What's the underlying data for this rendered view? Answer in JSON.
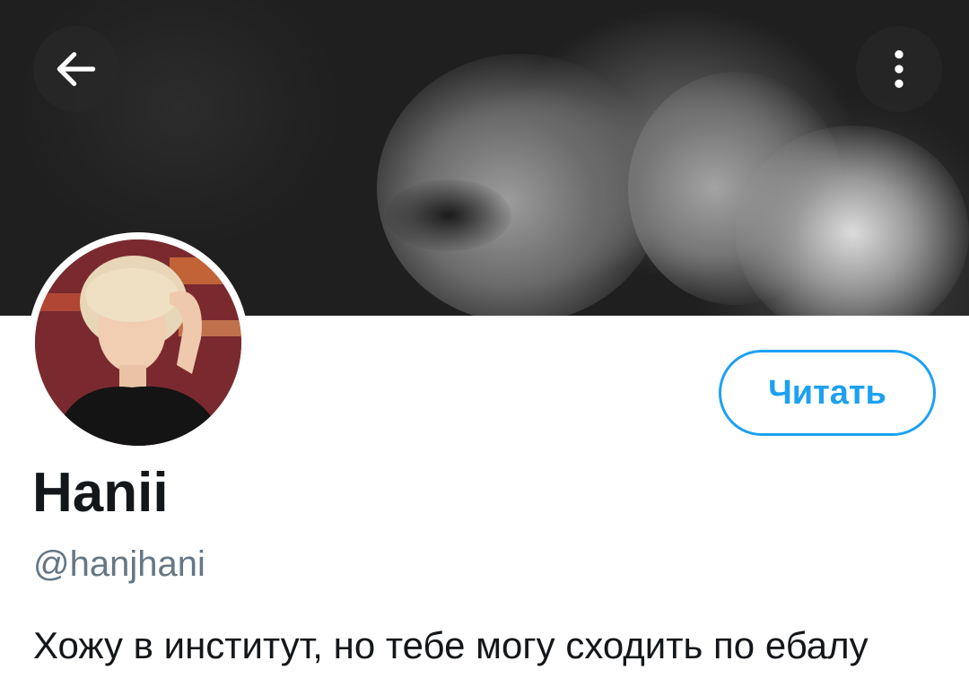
{
  "header": {
    "back_icon": "arrow-left-icon",
    "more_icon": "more-vertical-icon"
  },
  "profile": {
    "display_name": "Hanii",
    "handle": "@hanjhani",
    "bio": "Хожу в институт, но тебе могу сходить по ебалу",
    "follow_label": "Читать"
  },
  "colors": {
    "accent": "#1da1f2",
    "text_primary": "#14171a",
    "text_secondary": "#657786"
  }
}
